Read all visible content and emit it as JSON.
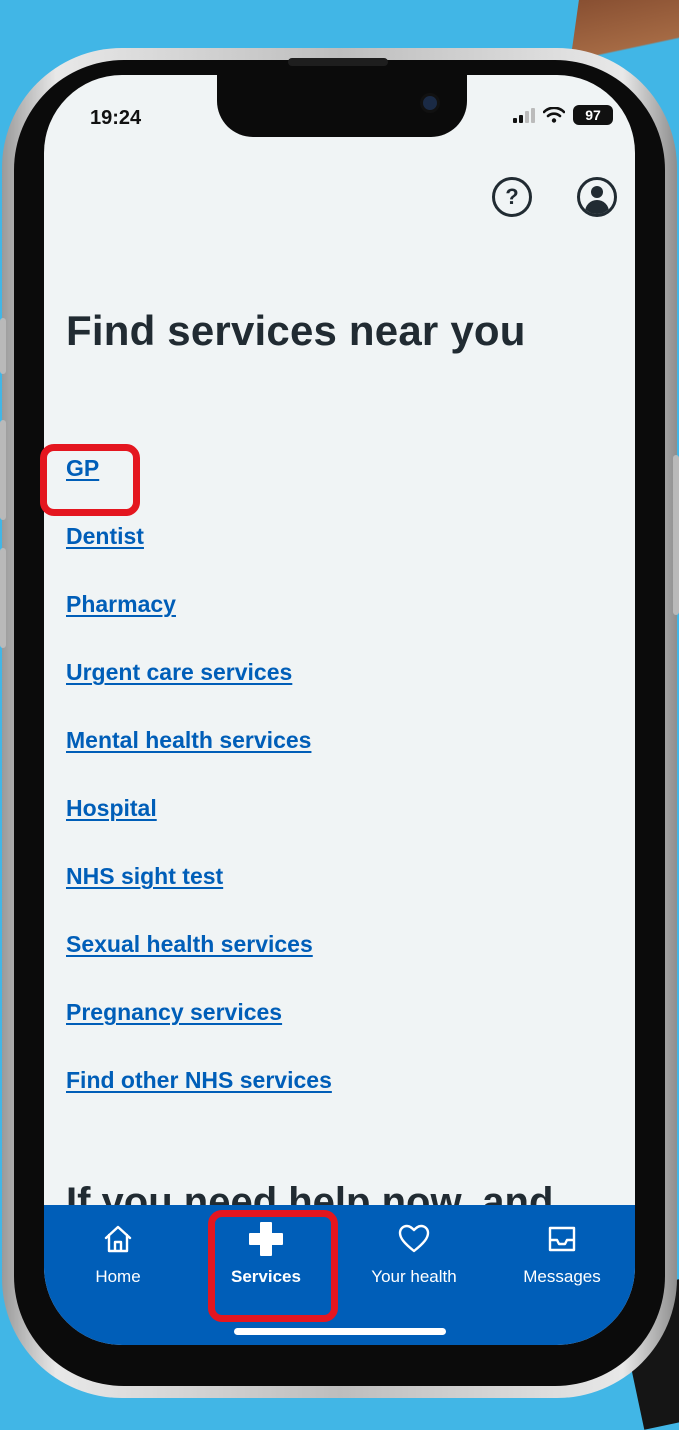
{
  "status_bar": {
    "time": "19:24",
    "battery_level": "97"
  },
  "header": {
    "help_icon": "question-circle-icon",
    "help_glyph": "?",
    "profile_icon": "account-icon"
  },
  "page": {
    "title": "Find services near you"
  },
  "services": [
    {
      "label": "GP"
    },
    {
      "label": "Dentist"
    },
    {
      "label": "Pharmacy"
    },
    {
      "label": "Urgent care services"
    },
    {
      "label": "Mental health services"
    },
    {
      "label": "Hospital"
    },
    {
      "label": "NHS sight test"
    },
    {
      "label": "Sexual health services"
    },
    {
      "label": "Pregnancy services"
    },
    {
      "label": "Find other NHS services"
    }
  ],
  "next_section": {
    "heading_partial": "If you need help now, and"
  },
  "tab_bar": {
    "tabs": [
      {
        "label": "Home",
        "icon": "home-icon"
      },
      {
        "label": "Services",
        "icon": "plus-icon"
      },
      {
        "label": "Your health",
        "icon": "heart-icon"
      },
      {
        "label": "Messages",
        "icon": "inbox-icon"
      }
    ],
    "active": "Services"
  },
  "colors": {
    "nhs_blue": "#005eb8",
    "text_dark": "#212b32",
    "page_bg": "#f0f4f5",
    "highlight_red": "#e4161f",
    "backdrop": "#41b6e6"
  }
}
